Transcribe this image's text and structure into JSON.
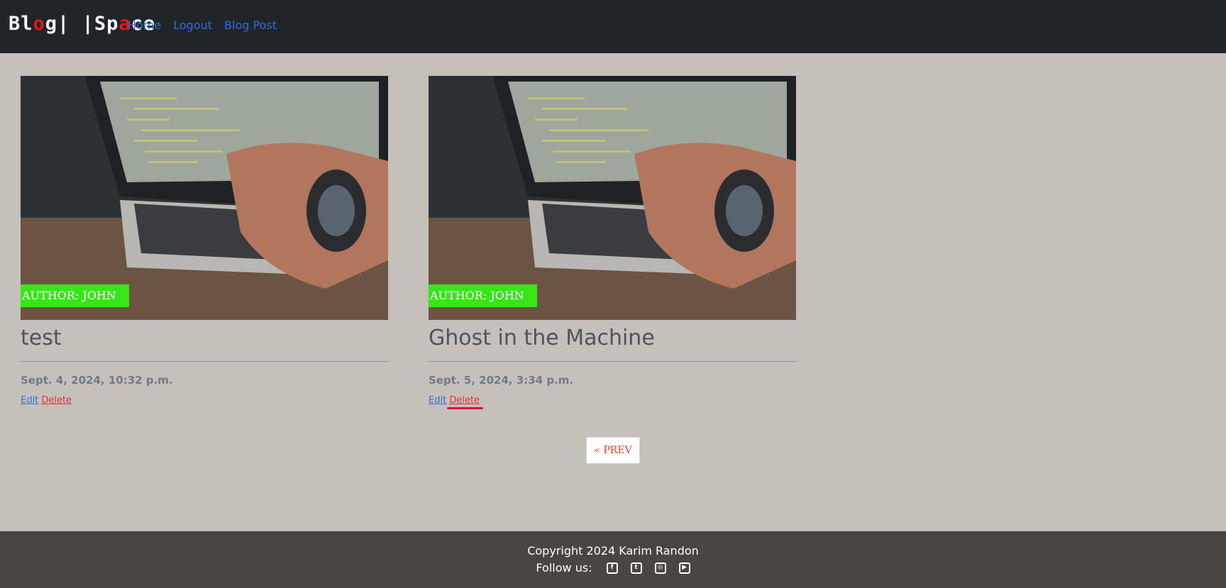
{
  "brand": {
    "part1": "Bl",
    "part2": "o",
    "part3": "g",
    "sep": "| |",
    "part4": "Sp",
    "part5": "a",
    "part6": "ce"
  },
  "nav": {
    "home": "Home",
    "logout": "Logout",
    "blog_post": "Blog Post"
  },
  "posts": [
    {
      "author_label": "AUTHOR: JOHN",
      "title": "test",
      "date": "Sept. 4, 2024, 10:32 p.m.",
      "edit": "Edit",
      "delete": "Delete"
    },
    {
      "author_label": "AUTHOR: JOHN",
      "title": "Ghost in the Machine",
      "date": "Sept. 5, 2024, 3:34 p.m.",
      "edit": "Edit",
      "delete": "Delete"
    }
  ],
  "pagination": {
    "prev": "« PREV"
  },
  "footer": {
    "copyright": "Copyright 2024 Karim Randon",
    "follow": "Follow us:",
    "icons": [
      "facebook-icon",
      "twitter-icon",
      "instagram-icon",
      "youtube-icon"
    ]
  },
  "colors": {
    "author_badge": "#38e618",
    "nav_bg": "#212529",
    "page_bg": "#c5c0ba",
    "footer_bg": "#4a4540",
    "link": "#2f6bdc",
    "delete": "#e0303a"
  }
}
